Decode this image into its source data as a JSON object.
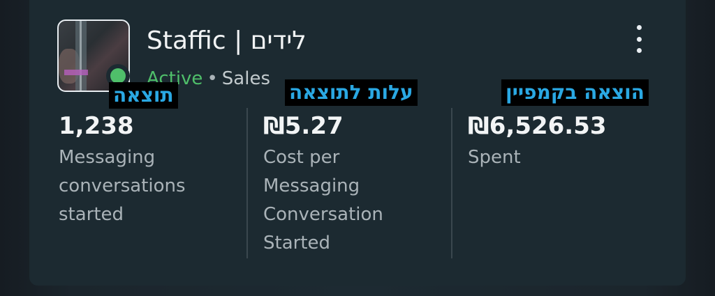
{
  "campaign": {
    "title": "Staffic | לידים",
    "status": "Active",
    "separator": "•",
    "category": "Sales"
  },
  "annotations": [
    {
      "text": "תוצאה"
    },
    {
      "text": "עלות לתוצאה"
    },
    {
      "text": "הוצאה בקמפיין"
    }
  ],
  "metrics": [
    {
      "value": "1,238",
      "label": "Messaging\nconversations\nstarted"
    },
    {
      "value": "₪5.27",
      "label": "Cost per\nMessaging\nConversation\nStarted"
    },
    {
      "value": "₪6,526.53",
      "label": "Spent"
    }
  ],
  "colors": {
    "active": "#4fbf6a",
    "annotation_text": "#2aa8e3",
    "card_bg": "#1c2a31"
  },
  "icons": {
    "menu": "kebab-more-icon",
    "status": "active-status-dot-icon"
  }
}
